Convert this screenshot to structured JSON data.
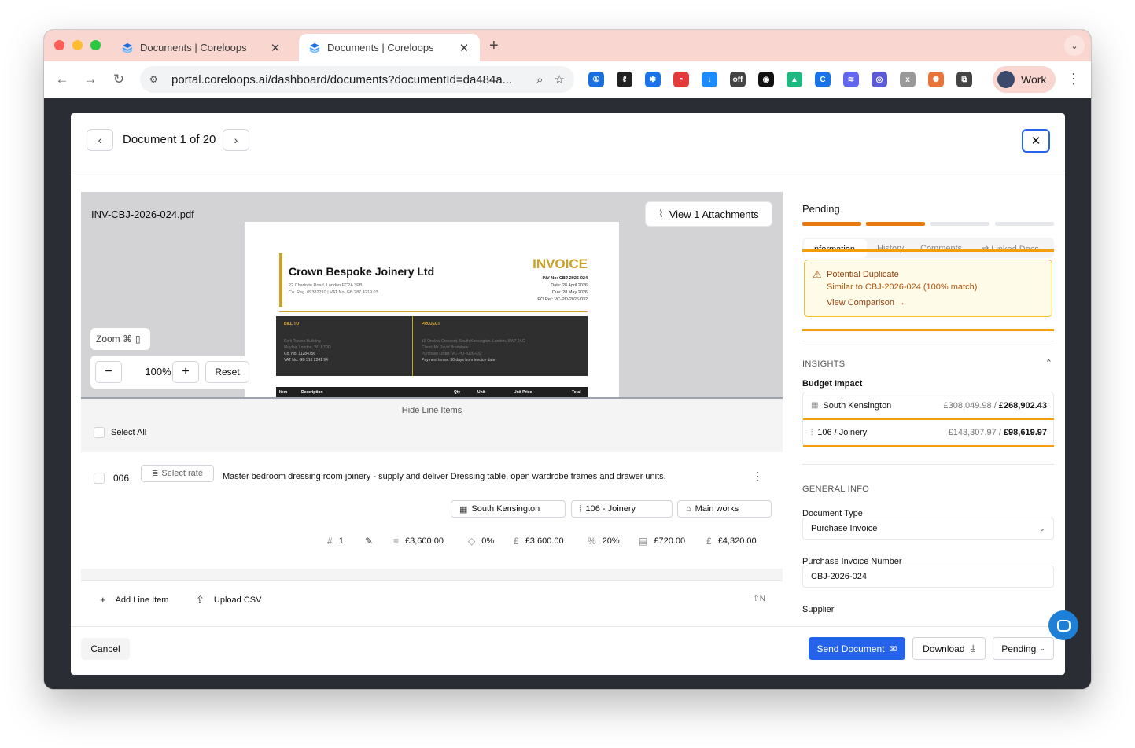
{
  "browser": {
    "tabs": [
      {
        "title": "Documents | Coreloops",
        "active": false
      },
      {
        "title": "Documents | Coreloops",
        "active": true
      }
    ],
    "url": "portal.coreloops.ai/dashboard/documents?documentId=da484a...",
    "profile": "Work",
    "extensions": [
      {
        "icon": "1password-icon",
        "color": "#1a6fe0",
        "glyph": "①"
      },
      {
        "icon": "signature-icon",
        "color": "#222222",
        "glyph": "ℓ"
      },
      {
        "icon": "snowflake-icon",
        "color": "#1a73e8",
        "glyph": "✱"
      },
      {
        "icon": "pokeball-icon",
        "color": "#e33a3a",
        "glyph": "◓"
      },
      {
        "icon": "download-icon",
        "color": "#1a8cff",
        "glyph": "↓"
      },
      {
        "icon": "off-badge-icon",
        "color": "#444444",
        "glyph": "off"
      },
      {
        "icon": "disk-icon",
        "color": "#111111",
        "glyph": "◉"
      },
      {
        "icon": "android-icon",
        "color": "#1eb980",
        "glyph": "▲"
      },
      {
        "icon": "c-circle-icon",
        "color": "#1a73e8",
        "glyph": "C"
      },
      {
        "icon": "waveform-icon",
        "color": "#6366f1",
        "glyph": "≋"
      },
      {
        "icon": "swirl-icon",
        "color": "#5b5bd6",
        "glyph": "◎"
      },
      {
        "icon": "blocked-ext-icon",
        "color": "#999999",
        "glyph": "x"
      },
      {
        "icon": "sunburst-icon",
        "color": "#e8743b",
        "glyph": "✺"
      },
      {
        "icon": "puzzle-icon",
        "color": "#444444",
        "glyph": "⧉"
      }
    ]
  },
  "modal": {
    "doc_counter": "Document 1 of 20",
    "preview": {
      "filename": "INV-CBJ-2026-024.pdf",
      "attachments_label": "View 1 Attachments",
      "zoom_label": "Zoom ⌘",
      "zoom_value": "100%",
      "reset_label": "Reset"
    },
    "invoice": {
      "company": "Crown Bespoke Joinery Ltd",
      "address": "22 Charlotte Road, London EC2A 3PB",
      "reg": "Co. Reg. 09382710 | VAT No. GB 287 4219 03",
      "title": "INVOICE",
      "inv_no": "INV No: CBJ-2026-024",
      "date": "Date: 28 April 2026",
      "due": "Due: 28 May 2026",
      "po": "PO Ref: VC-PO-2026-032",
      "bill_to_label": "BILL TO",
      "bill_to_lines": [
        "Park Towers Building",
        "Mayfair, London, W1J 7DD"
      ],
      "bill_to_co": "Co. No. 11284756",
      "bill_to_vat": "VAT No. GB 316 2241 94",
      "project_label": "PROJECT",
      "project_lines": [
        "16 Onslow Crescent, South Kensington, London, SW7 2AG",
        "Client: Mr David Bradshaw",
        "Purchase Order: VC-PO-2026-032"
      ],
      "project_terms": "Payment terms: 30 days from invoice date",
      "table_headers": [
        "Item",
        "Description",
        "Qty",
        "Unit",
        "Unit Price",
        "Total"
      ]
    },
    "line_items": {
      "hide_label": "Hide Line Items",
      "select_all": "Select All",
      "rows": [
        {
          "code": "006",
          "rate_label": "Select rate",
          "description": "Master bedroom dressing room joinery - supply and deliver Dressing table, open wardrobe frames and drawer units.",
          "tags": [
            "South Kensington",
            "106 - Joinery",
            "Main works"
          ],
          "quantity": "1",
          "net": "£3,600.00",
          "discount": "0%",
          "subtotal": "£3,600.00",
          "vat_rate": "20%",
          "vat_amount": "£720.00",
          "total": "£4,320.00"
        }
      ],
      "add_label": "Add Line Item",
      "upload_label": "Upload CSV",
      "shortcut": "⇧N"
    },
    "side": {
      "status": "Pending",
      "progress_steps_done": 2,
      "progress_steps_total": 4,
      "tabs": [
        "Information",
        "History",
        "Comments",
        "Linked Docs"
      ],
      "duplicate": {
        "title": "Potential Duplicate",
        "detail": "Similar to CBJ-2026-024 (100% match)",
        "link": "View Comparison →"
      },
      "insights_label": "INSIGHTS",
      "budget_label": "Budget Impact",
      "budget_rows": [
        {
          "label": "South Kensington",
          "from": "£308,049.98",
          "to": "£268,902.43"
        },
        {
          "label": "106 / Joinery",
          "from": "£143,307.97",
          "to": "£98,619.97"
        }
      ],
      "general_label": "GENERAL INFO",
      "doc_type_label": "Document Type",
      "doc_type_value": "Purchase Invoice",
      "pi_number_label": "Purchase Invoice Number",
      "pi_number_value": "CBJ-2026-024",
      "supplier_label": "Supplier"
    },
    "footer": {
      "cancel": "Cancel",
      "send": "Send Document",
      "download": "Download",
      "status": "Pending"
    }
  },
  "colors": {
    "accent": "#2563eb",
    "progress_done": "#e8780e",
    "progress_todo": "#e5e7eb",
    "warning": "#f59e0b",
    "tab_strip": "#f9d6cf"
  }
}
